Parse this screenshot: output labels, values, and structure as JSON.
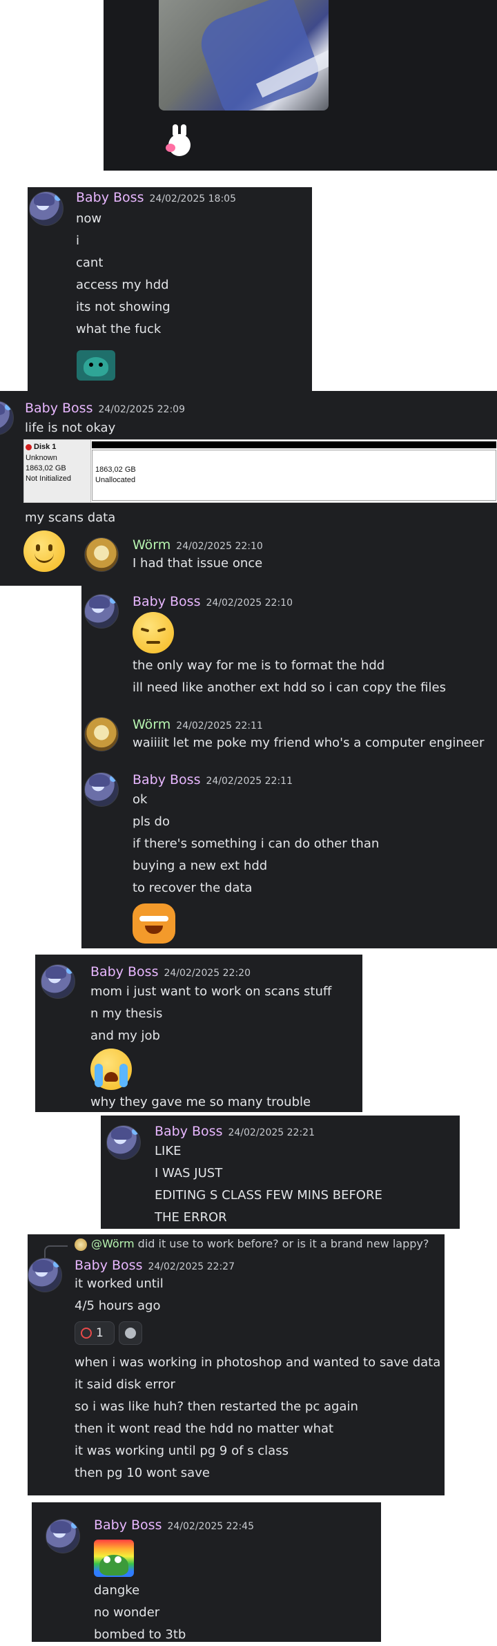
{
  "messages": {
    "m1": {
      "author": "Baby Boss",
      "time": "24/02/2025 18:05",
      "lines": [
        "now",
        "i",
        "cant",
        "access my hdd",
        "its not showing",
        "what the fuck"
      ]
    },
    "m2": {
      "author": "Baby Boss",
      "time": "24/02/2025 22:09",
      "lines": [
        "life is not okay"
      ],
      "after": "my scans data",
      "disk": {
        "title": "Disk 1",
        "type": "Unknown",
        "size": "1863,02 GB",
        "status": "Not Initialized",
        "part_size": "1863,02 GB",
        "part_status": "Unallocated"
      }
    },
    "m3": {
      "author": "Wörm",
      "time": "24/02/2025 22:10",
      "lines": [
        "I had that issue once"
      ]
    },
    "m4": {
      "author": "Baby Boss",
      "time": "24/02/2025 22:10",
      "lines": [
        "the only way for me is to format the hdd",
        "ill need like another ext hdd so i can copy the files"
      ]
    },
    "m5": {
      "author": "Wörm",
      "time": "24/02/2025 22:11",
      "lines": [
        "waiiiit let me poke my friend who's a computer engineer"
      ]
    },
    "m6": {
      "author": "Baby Boss",
      "time": "24/02/2025 22:11",
      "lines": [
        "ok",
        "pls do",
        "if there's something i can do other than",
        "buying a new ext hdd",
        "to recover the data"
      ]
    },
    "m7": {
      "author": "Baby Boss",
      "time": "24/02/2025 22:20",
      "lines": [
        "mom i just want to work on scans stuff",
        "n my thesis",
        "and my job"
      ],
      "after": "why they gave me so many trouble"
    },
    "m8": {
      "author": "Baby Boss",
      "time": "24/02/2025 22:21",
      "lines": [
        "LIKE",
        "I WAS JUST",
        "EDITING S CLASS FEW MINS BEFORE",
        "THE ERROR"
      ]
    },
    "m9": {
      "reply_author": "@Wörm",
      "reply_text": "did it use to work before? or is it a brand new lappy?",
      "author": "Baby Boss",
      "time": "24/02/2025 22:27",
      "lines_a": [
        "it worked until",
        "4/5 hours ago"
      ],
      "reaction_count": "1",
      "lines_b": [
        "when i was working in photoshop and wanted to save data",
        "it said disk error",
        "so i was like huh? then restarted the pc again",
        "then it wont read the hdd no matter what",
        "it was working until pg 9 of s class",
        "then pg 10 wont save"
      ]
    },
    "m10": {
      "author": "Baby Boss",
      "time": "24/02/2025 22:45",
      "lines": [
        "dangke",
        "no wonder",
        "bombed to 3tb"
      ]
    }
  },
  "colors": {
    "panel": "#1e1f22",
    "author": "#e8b7ff",
    "worm": "#b7f5b0",
    "text": "#e3e5e8"
  }
}
